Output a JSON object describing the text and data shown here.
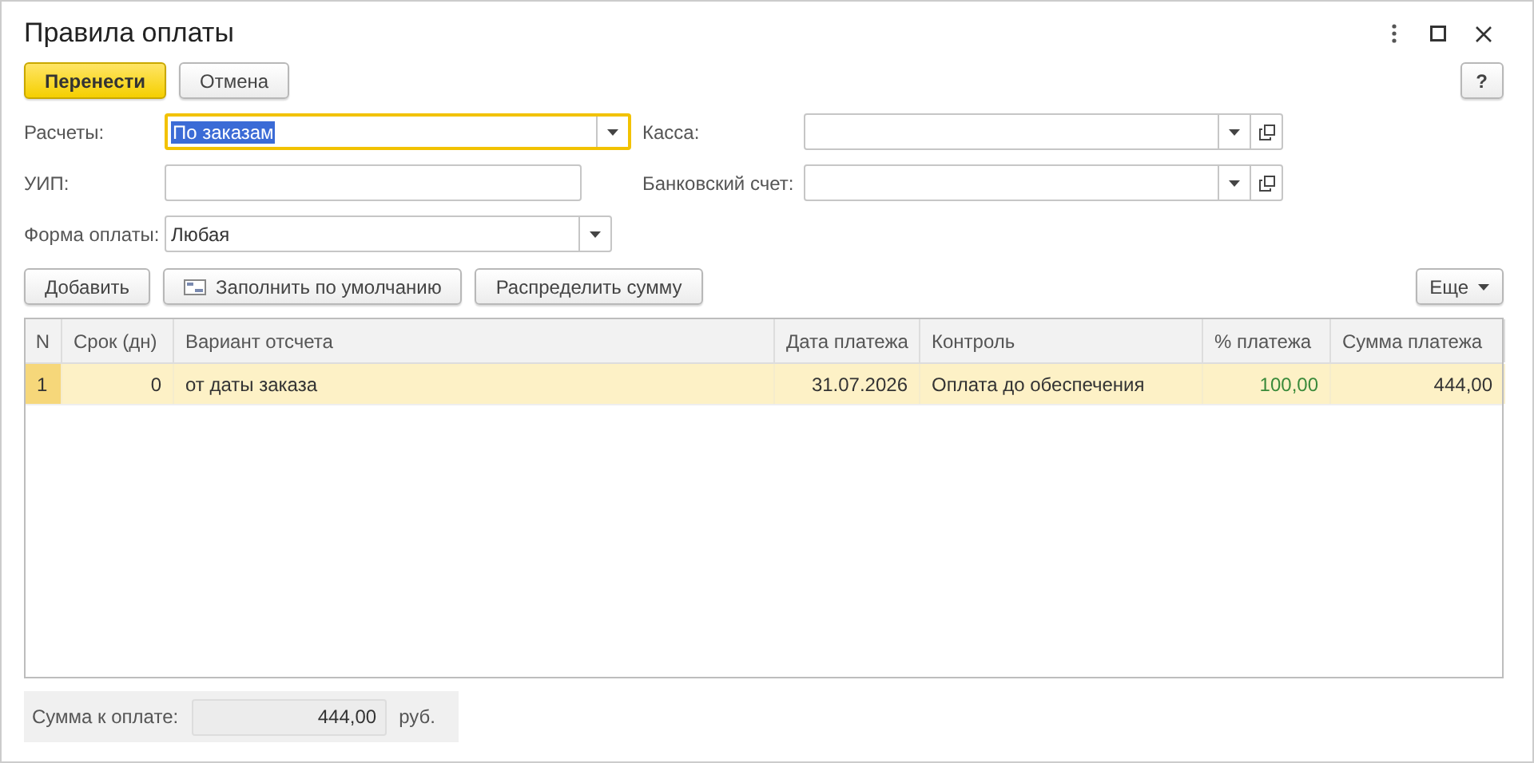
{
  "window": {
    "title": "Правила оплаты"
  },
  "toolbar": {
    "buttons": [
      {
        "label": "Перенести",
        "kind": "primary"
      },
      {
        "label": "Отмена",
        "kind": "normal"
      }
    ],
    "help": "?"
  },
  "fields_left": [
    {
      "label": "Расчеты:",
      "value": "По заказам",
      "kind": "dropdown",
      "focused": true
    },
    {
      "label": "УИП:",
      "kind": "text",
      "focused": false
    },
    {
      "label": "Форма оплаты:",
      "value": "Любая",
      "kind": "dropdown",
      "focused": false
    }
  ],
  "fields_right": [
    {
      "label": "Касса:"
    },
    {
      "label": "Банковский счет:"
    }
  ],
  "table_buttons": [
    {
      "label": "Добавить",
      "icon": false
    },
    {
      "label": "Заполнить по умолчанию",
      "icon": true
    },
    {
      "label": "Распределить сумму",
      "icon": false
    }
  ],
  "more_button": "Еще",
  "table": {
    "columns": [
      "N",
      "Срок (дн)",
      "Вариант отсчета",
      "Дата платежа",
      "Контроль",
      "% платежа",
      "Сумма платежа"
    ],
    "rows": [
      {
        "selected": true,
        "cells": [
          "1",
          "0",
          "от даты заказа",
          "31.07.2026",
          "Оплата до обеспечения",
          "100,00",
          "444,00"
        ]
      }
    ]
  },
  "footer": {
    "label": "Сумма к оплате:",
    "value": "444,00",
    "unit": "руб."
  }
}
